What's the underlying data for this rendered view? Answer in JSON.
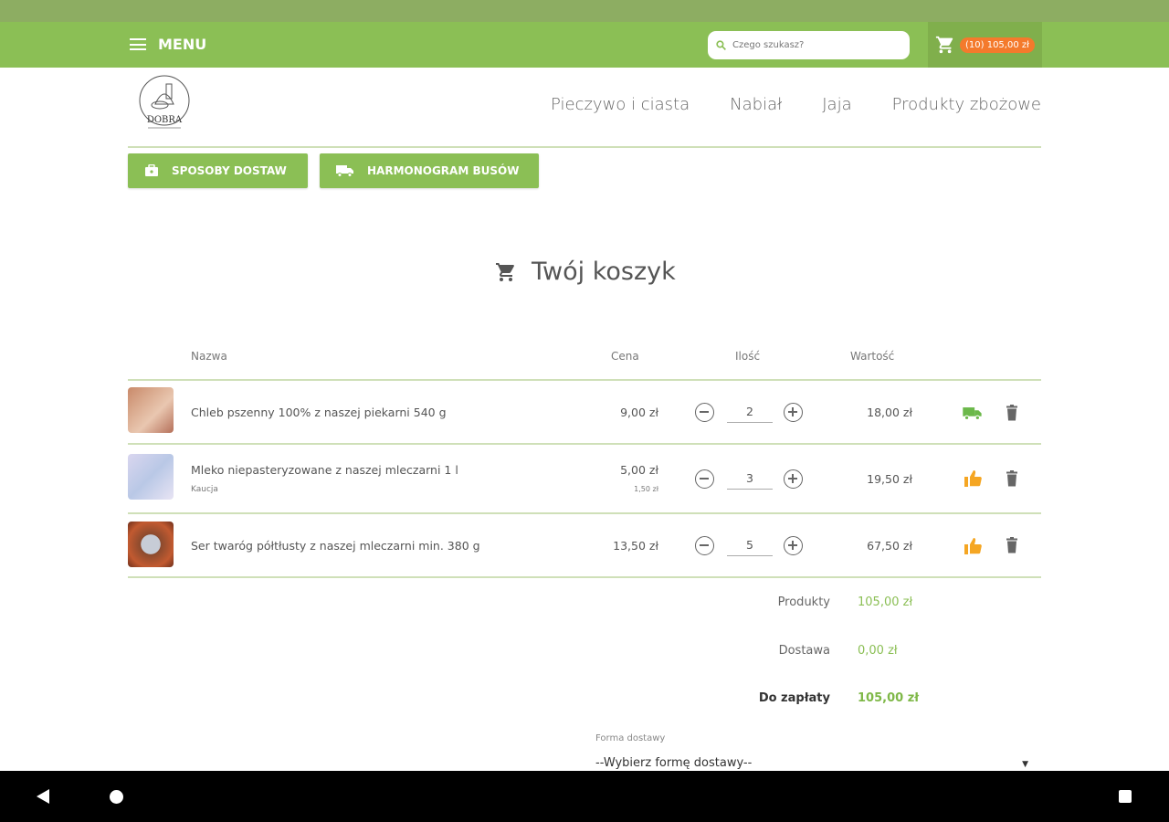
{
  "topbar": {
    "menu_label": "MENU",
    "search_placeholder": "Czego szukasz?",
    "cart_badge": "(10) 105,00 zł"
  },
  "header": {
    "logo_text": "DOBRA",
    "nav": [
      "Pieczywo i ciasta",
      "Nabiał",
      "Jaja",
      "Produkty zbożowe"
    ]
  },
  "buttons": {
    "delivery_methods": "SPOSOBY DOSTAW",
    "bus_schedule": "HARMONOGRAM BUSÓW"
  },
  "page_title": "Twój koszyk",
  "table": {
    "headers": {
      "name": "Nazwa",
      "price": "Cena",
      "qty": "Ilość",
      "value": "Wartość"
    },
    "rows": [
      {
        "name": "Chleb pszenny 100% z naszej piekarni 540 g",
        "sub": "",
        "price": "9,00 zł",
        "price_sub": "",
        "qty": "2",
        "value": "18,00 zł",
        "status_icon": "truck-icon",
        "status_color": "#6bb84a"
      },
      {
        "name": "Mleko niepasteryzowane z naszej mleczarni 1 l",
        "sub": "Kaucja",
        "price": "5,00 zł",
        "price_sub": "1,50 zł",
        "qty": "3",
        "value": "19,50 zł",
        "status_icon": "thumbs-up-icon",
        "status_color": "#f5a623"
      },
      {
        "name": "Ser twaróg półtłusty z naszej mleczarni min. 380 g",
        "sub": "",
        "price": "13,50 zł",
        "price_sub": "",
        "qty": "5",
        "value": "67,50 zł",
        "status_icon": "thumbs-up-icon",
        "status_color": "#f5a623"
      }
    ]
  },
  "summary": {
    "products_label": "Produkty",
    "products_value": "105,00 zł",
    "delivery_label": "Dostawa",
    "delivery_value": "0,00 zł",
    "total_label": "Do zapłaty",
    "total_value": "105,00 zł"
  },
  "delivery_form": {
    "label": "Forma dostawy",
    "selected": "--Wybierz formę dostawy--"
  },
  "colors": {
    "primary_green": "#8bbf55",
    "badge_orange": "#f47a2c",
    "status_orange": "#f5a623"
  }
}
